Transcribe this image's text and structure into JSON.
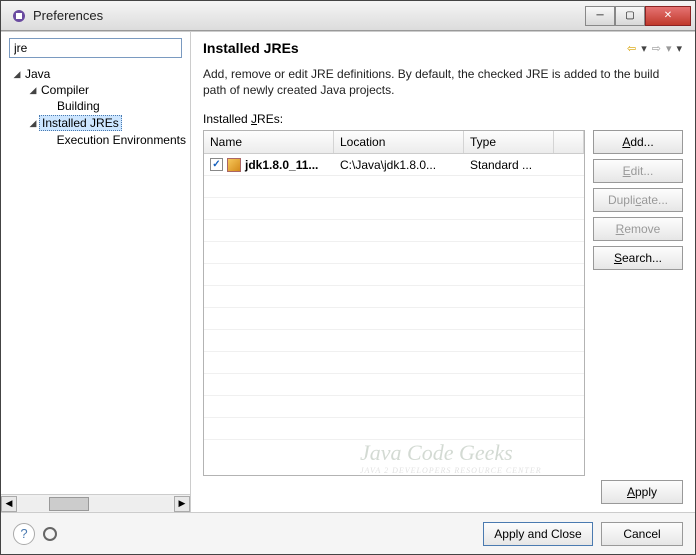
{
  "window": {
    "title": "Preferences"
  },
  "sidebar": {
    "search_value": "jre",
    "items": [
      {
        "label": "Java",
        "level": 0,
        "expanded": true
      },
      {
        "label": "Compiler",
        "level": 1,
        "expanded": true
      },
      {
        "label": "Building",
        "level": 2,
        "expanded": false
      },
      {
        "label": "Installed JREs",
        "level": 1,
        "expanded": true,
        "selected": true
      },
      {
        "label": "Execution Environments",
        "level": 2,
        "expanded": false
      }
    ]
  },
  "main": {
    "title": "Installed JREs",
    "description": "Add, remove or edit JRE definitions. By default, the checked JRE is added to the build path of newly created Java projects.",
    "section_label_pre": "Installed ",
    "section_label_underline": "J",
    "section_label_post": "REs:",
    "table": {
      "columns": [
        "Name",
        "Location",
        "Type",
        ""
      ],
      "rows": [
        {
          "checked": true,
          "name": "jdk1.8.0_11...",
          "location": "C:\\Java\\jdk1.8.0...",
          "type": "Standard ..."
        }
      ]
    },
    "buttons": {
      "add": "Add...",
      "edit": "Edit...",
      "duplicate": "Duplicate...",
      "remove": "Remove",
      "search": "Search..."
    },
    "apply": "Apply"
  },
  "footer": {
    "apply_close": "Apply and Close",
    "cancel": "Cancel"
  },
  "watermark": {
    "text": "Java Code Geeks",
    "sub": "JAVA 2 DEVELOPERS RESOURCE CENTER"
  }
}
